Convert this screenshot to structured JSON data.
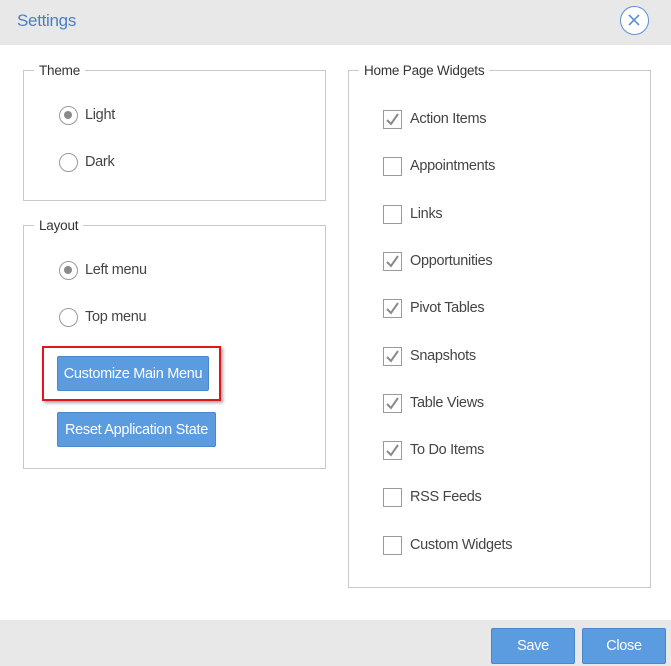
{
  "dialog": {
    "title": "Settings"
  },
  "theme": {
    "legend": "Theme",
    "options": [
      {
        "label": "Light",
        "selected": true
      },
      {
        "label": "Dark",
        "selected": false
      }
    ]
  },
  "layout": {
    "legend": "Layout",
    "options": [
      {
        "label": "Left menu",
        "selected": true
      },
      {
        "label": "Top menu",
        "selected": false
      }
    ],
    "customize_label": "Customize Main Menu",
    "reset_label": "Reset Application State"
  },
  "widgets": {
    "legend": "Home Page Widgets",
    "items": [
      {
        "label": "Action Items",
        "checked": true
      },
      {
        "label": "Appointments",
        "checked": false
      },
      {
        "label": "Links",
        "checked": false
      },
      {
        "label": "Opportunities",
        "checked": true
      },
      {
        "label": "Pivot Tables",
        "checked": true
      },
      {
        "label": "Snapshots",
        "checked": true
      },
      {
        "label": "Table Views",
        "checked": true
      },
      {
        "label": "To Do Items",
        "checked": true
      },
      {
        "label": "RSS Feeds",
        "checked": false
      },
      {
        "label": "Custom Widgets",
        "checked": false
      }
    ]
  },
  "footer": {
    "save_label": "Save",
    "close_label": "Close"
  },
  "colors": {
    "accent": "#5b9be0",
    "title": "#4a7fc1",
    "highlight": "#e0161d"
  }
}
